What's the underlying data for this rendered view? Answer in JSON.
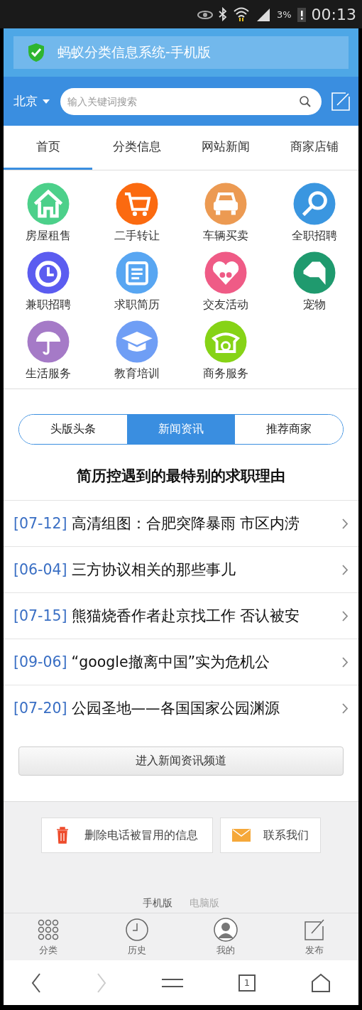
{
  "status_bar": {
    "battery": "3%",
    "time": "00:13"
  },
  "title_bar": {
    "title": "蚂蚁分类信息系统-手机版"
  },
  "header": {
    "city": "北京",
    "search": {
      "placeholder": "输入关键词搜索"
    }
  },
  "tabs": [
    {
      "label": "首页",
      "selected": true
    },
    {
      "label": "分类信息",
      "selected": false
    },
    {
      "label": "网站新闻",
      "selected": false
    },
    {
      "label": "商家店铺",
      "selected": false
    }
  ],
  "categories": [
    {
      "label": "房屋租售",
      "color": "#4cd08a"
    },
    {
      "label": "二手转让",
      "color": "#fb6a10"
    },
    {
      "label": "车辆买卖",
      "color": "#ec9a52"
    },
    {
      "label": "全职招聘",
      "color": "#3a96e0"
    },
    {
      "label": "兼职招聘",
      "color": "#5b5cf0"
    },
    {
      "label": "求职简历",
      "color": "#58a6f2"
    },
    {
      "label": "交友活动",
      "color": "#ef5b86"
    },
    {
      "label": "宠物",
      "color": "#1f9a6e"
    },
    {
      "label": "生活服务",
      "color": "#a57ac7"
    },
    {
      "label": "教育培训",
      "color": "#6f9ef5"
    },
    {
      "label": "商务服务",
      "color": "#86d316"
    }
  ],
  "news_tabs": [
    {
      "label": "头版头条",
      "selected": false
    },
    {
      "label": "新闻资讯",
      "selected": true
    },
    {
      "label": "推荐商家",
      "selected": false
    }
  ],
  "headline": "简历控遇到的最特别的求职理由",
  "news": [
    {
      "date": "[07-12]",
      "title": "高清组图：合肥突降暴雨 市区内涝"
    },
    {
      "date": "[06-04]",
      "title": "三方协议相关的那些事儿"
    },
    {
      "date": "[07-15]",
      "title": "熊猫烧香作者赴京找工作 否认被安"
    },
    {
      "date": "[09-06]",
      "title": "“google撤离中国”实为危机公"
    },
    {
      "date": "[07-20]",
      "title": "公园圣地——各国国家公园渊源"
    }
  ],
  "more_button": "进入新闻资讯频道",
  "footer": {
    "buttons": [
      "删除电话被冒用的信息",
      "联系我们"
    ],
    "versions": [
      {
        "label": "手机版",
        "selected": true
      },
      {
        "label": "电脑版",
        "selected": false
      }
    ]
  },
  "bottom_nav": [
    {
      "label": "分类"
    },
    {
      "label": "历史"
    },
    {
      "label": "我的"
    },
    {
      "label": "发布"
    }
  ],
  "browser_bar": {
    "back_disabled": false,
    "forward_disabled": true,
    "tab_count": "1"
  }
}
